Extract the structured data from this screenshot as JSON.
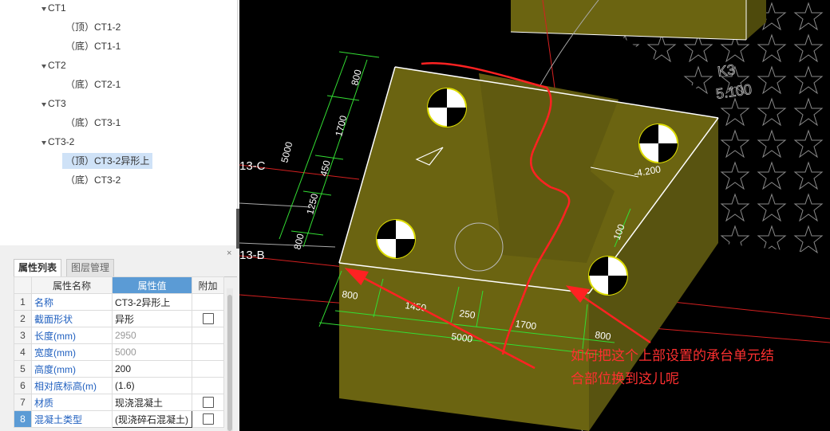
{
  "tree": {
    "items": [
      {
        "label": "CT1",
        "level": 0,
        "expanded": true
      },
      {
        "label": "（顶）CT1-2",
        "level": 1
      },
      {
        "label": "（底）CT1-1",
        "level": 1
      },
      {
        "label": "CT2",
        "level": 0,
        "expanded": true
      },
      {
        "label": "（底）CT2-1",
        "level": 1
      },
      {
        "label": "CT3",
        "level": 0,
        "expanded": true
      },
      {
        "label": "（底）CT3-1",
        "level": 1
      },
      {
        "label": "CT3-2",
        "level": 0,
        "expanded": true
      },
      {
        "label": "（顶）CT3-2异形上",
        "level": 1,
        "selected": true
      },
      {
        "label": "（底）CT3-2",
        "level": 1
      }
    ]
  },
  "panel": {
    "tabs": [
      "属性列表",
      "图层管理"
    ],
    "active_tab": "属性列表",
    "close": "×",
    "headers": {
      "name": "属性名称",
      "value": "属性值",
      "extra": "附加"
    },
    "rows": [
      {
        "n": "1",
        "name": "名称",
        "value": "CT3-2异形上",
        "checkbox": false
      },
      {
        "n": "2",
        "name": "截面形状",
        "value": "异形",
        "checkbox": true
      },
      {
        "n": "3",
        "name": "长度(mm)",
        "value": "2950",
        "checkbox": false,
        "disabled": true
      },
      {
        "n": "4",
        "name": "宽度(mm)",
        "value": "5000",
        "checkbox": false,
        "disabled": true
      },
      {
        "n": "5",
        "name": "高度(mm)",
        "value": "200",
        "checkbox": false
      },
      {
        "n": "6",
        "name": "相对底标高(m)",
        "value": "(1.6)",
        "checkbox": false
      },
      {
        "n": "7",
        "name": "材质",
        "value": "现浇混凝土",
        "checkbox": true
      },
      {
        "n": "8",
        "name": "混凝土类型",
        "value": "(现浇碎石混凝土)",
        "checkbox": true,
        "selected": true
      }
    ]
  },
  "cad": {
    "axis_labels": [
      "13-C",
      "13-B"
    ],
    "elevation": "-4.200",
    "k3_label": "K3",
    "k3_value": "5.100",
    "dims_left": [
      "5000",
      "800",
      "1700",
      "450",
      "1250",
      "800"
    ],
    "dims_bottom": [
      "800",
      "1450",
      "250",
      "1700",
      "800",
      "5000"
    ],
    "dim_right": "100",
    "annotation_line1": "如何把这个上部设置的承台单元结",
    "annotation_line2": "合部位换到这儿呢",
    "colors": {
      "slab": "#6b6411",
      "dim": "#33dd33",
      "annotation": "#ff2222",
      "grid": "#dd2222"
    }
  }
}
